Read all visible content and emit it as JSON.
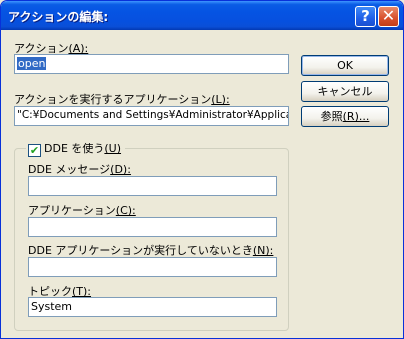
{
  "window": {
    "title": "アクションの編集:"
  },
  "titlebar": {
    "help_glyph": "?",
    "close_glyph": "✕"
  },
  "action": {
    "label": "アクション",
    "accel": "(A):",
    "value": "open"
  },
  "app": {
    "label": "アクションを実行するアプリケーション",
    "accel": "(L):",
    "value": "\"C:¥Documents and Settings¥Administrator¥Applica"
  },
  "buttons": {
    "ok": "OK",
    "cancel": "キャンセル",
    "browse": "参照",
    "browse_accel": "(R)..."
  },
  "dde": {
    "checkbox_label": "DDE を使う",
    "checkbox_accel": "(U)",
    "checked": true,
    "check_glyph": "✔",
    "message_label": "DDE メッセージ",
    "message_accel": "(D):",
    "message_value": "",
    "application_label": "アプリケーション",
    "application_accel": "(C):",
    "application_value": "",
    "not_running_label": "DDE アプリケーションが実行していないとき",
    "not_running_accel": "(N):",
    "not_running_value": "",
    "topic_label": "トピック",
    "topic_accel": "(T):",
    "topic_value": "System"
  }
}
